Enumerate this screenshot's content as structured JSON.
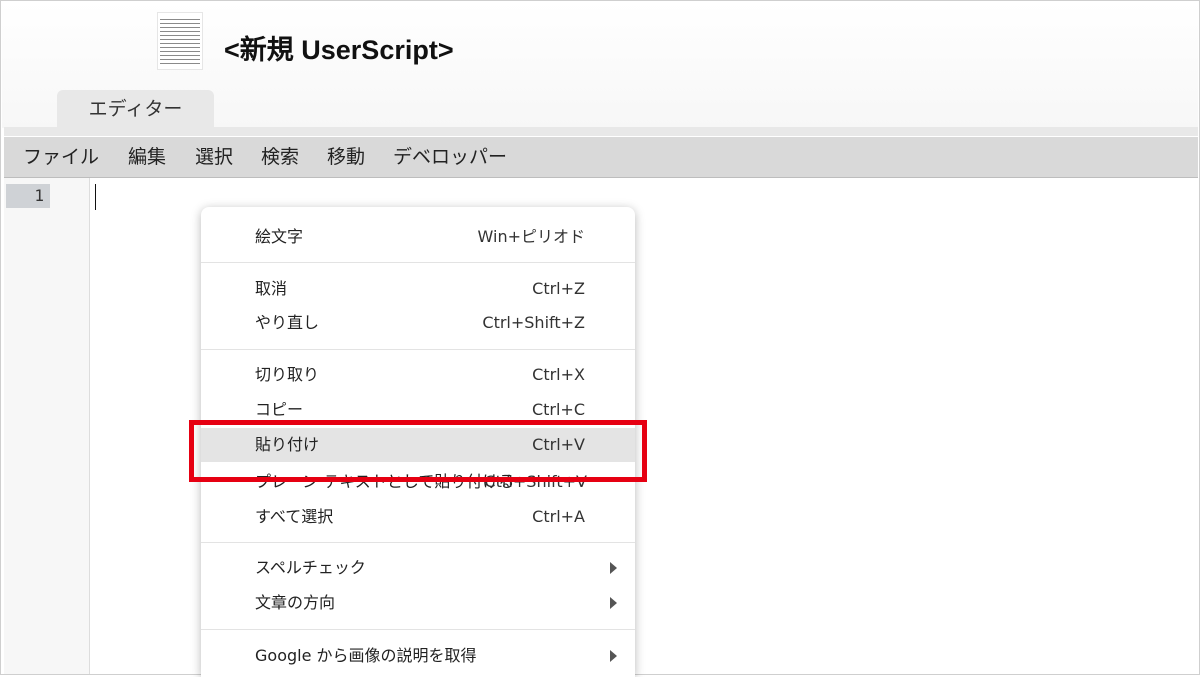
{
  "window": {
    "title": "<新規 UserScript>"
  },
  "tabs": [
    {
      "label": "エディター",
      "active": true
    }
  ],
  "menubar": {
    "items": [
      "ファイル",
      "編集",
      "選択",
      "検索",
      "移動",
      "デベロッパー"
    ]
  },
  "editor": {
    "line_numbers": [
      "1"
    ]
  },
  "context_menu": {
    "groups": [
      [
        {
          "label": "絵文字",
          "shortcut": "Win+ピリオド"
        }
      ],
      [
        {
          "label": "取消",
          "shortcut": "Ctrl+Z"
        },
        {
          "label": "やり直し",
          "shortcut": "Ctrl+Shift+Z"
        }
      ],
      [
        {
          "label": "切り取り",
          "shortcut": "Ctrl+X"
        },
        {
          "label": "コピー",
          "shortcut": "Ctrl+C"
        },
        {
          "label": "貼り付け",
          "shortcut": "Ctrl+V",
          "highlighted": true
        },
        {
          "label": "プレーン テキストとして貼り付ける",
          "shortcut": "Ctrl+Shift+V"
        },
        {
          "label": "すべて選択",
          "shortcut": "Ctrl+A"
        }
      ],
      [
        {
          "label": "スペルチェック",
          "submenu": true
        },
        {
          "label": "文章の方向",
          "submenu": true
        }
      ],
      [
        {
          "label": "Google から画像の説明を取得",
          "submenu": true
        }
      ]
    ]
  },
  "annotation": {
    "highlight_color": "#e60012",
    "target": "貼り付け"
  },
  "colors": {
    "menubar_bg": "#d9d9d9",
    "tab_bg": "#e8e8e8",
    "menu_highlight": "#e4e4e4"
  }
}
